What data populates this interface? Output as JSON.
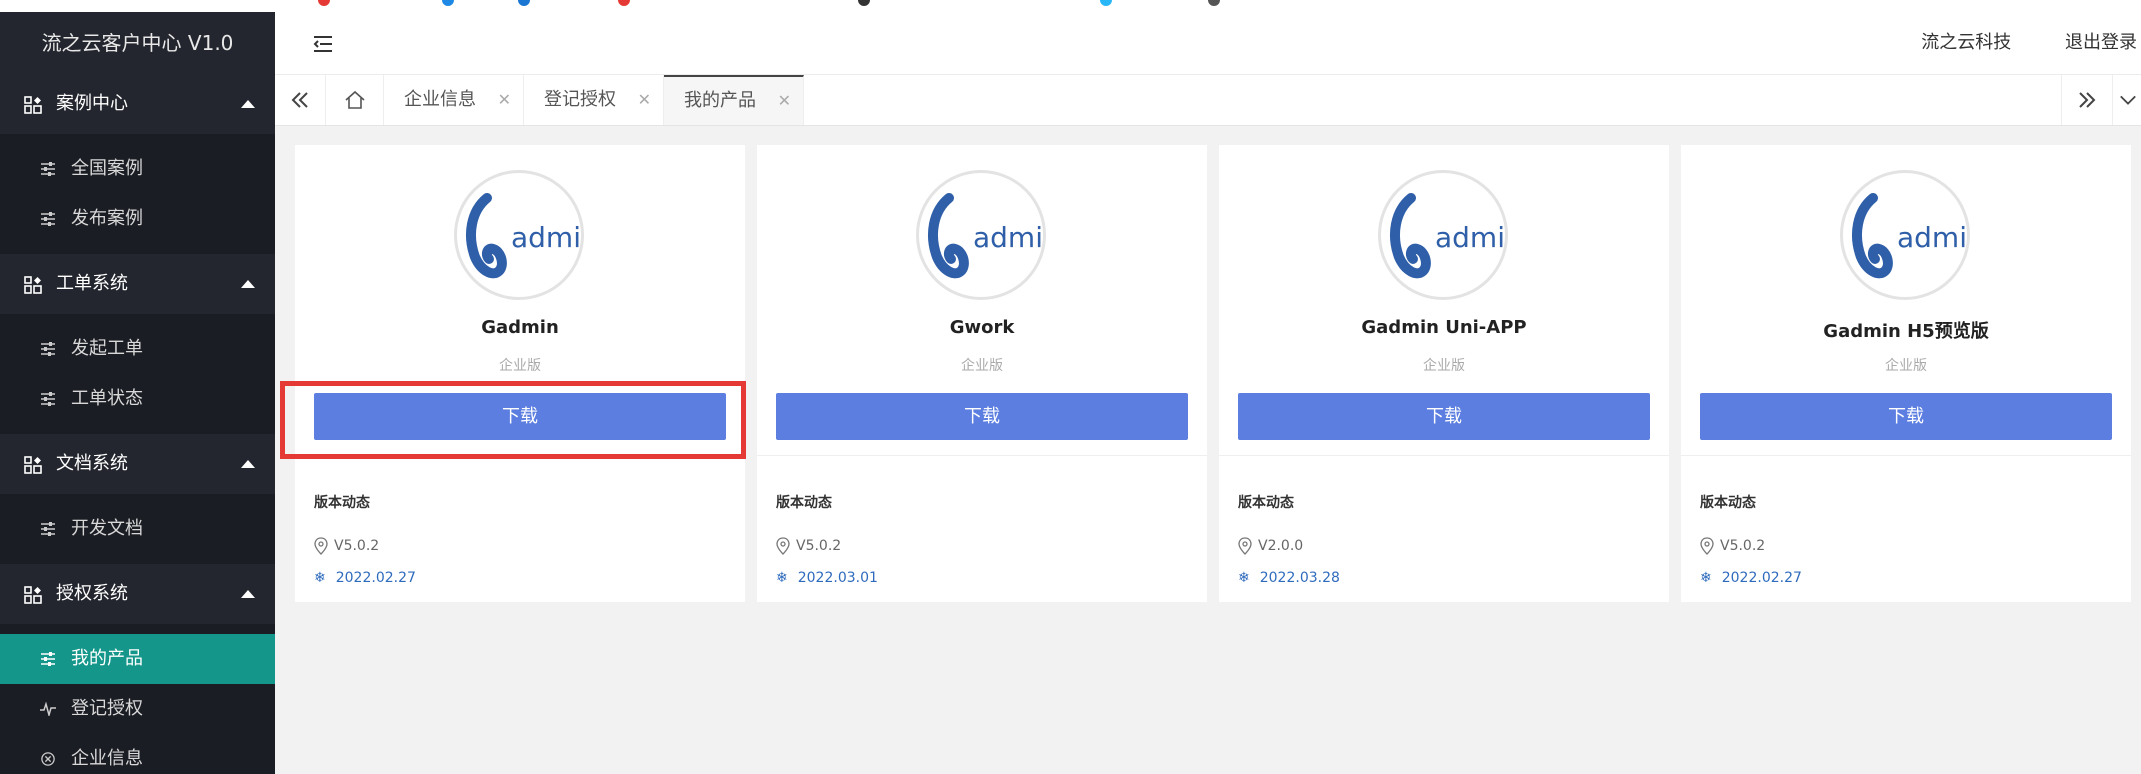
{
  "app": {
    "brand": "流之云客户中心 V1.0"
  },
  "header": {
    "company": "流之云科技",
    "logout": "退出登录"
  },
  "sidebar": {
    "groups": [
      {
        "title": "案例中心",
        "items": [
          {
            "label": "全国案例"
          },
          {
            "label": "发布案例"
          }
        ]
      },
      {
        "title": "工单系统",
        "items": [
          {
            "label": "发起工单"
          },
          {
            "label": "工单状态"
          }
        ]
      },
      {
        "title": "文档系统",
        "items": [
          {
            "label": "开发文档"
          }
        ]
      },
      {
        "title": "授权系统",
        "items": [
          {
            "label": "我的产品",
            "active": true
          },
          {
            "label": "登记授权"
          },
          {
            "label": "企业信息"
          }
        ]
      }
    ]
  },
  "tabs": [
    {
      "label": "企业信息"
    },
    {
      "label": "登记授权"
    },
    {
      "label": "我的产品",
      "active": true
    }
  ],
  "products": [
    {
      "name": "Gadmin",
      "edition": "企业版",
      "button": "下载",
      "news_label": "版本动态",
      "version": "V5.0.2",
      "date": "2022.02.27"
    },
    {
      "name": "Gwork",
      "edition": "企业版",
      "button": "下载",
      "news_label": "版本动态",
      "version": "V5.0.2",
      "date": "2022.03.01"
    },
    {
      "name": "Gadmin Uni-APP",
      "edition": "企业版",
      "button": "下载",
      "news_label": "版本动态",
      "version": "V2.0.0",
      "date": "2022.03.28"
    },
    {
      "name": "Gadmin H5预览版",
      "edition": "企业版",
      "button": "下载",
      "news_label": "版本动态",
      "version": "V5.0.2",
      "date": "2022.02.27"
    }
  ],
  "logo_text": "admin",
  "colors": {
    "accent": "#5b7ee0",
    "active_menu": "#14968a",
    "sidebar": "#20222a",
    "highlight": "#e53935"
  }
}
